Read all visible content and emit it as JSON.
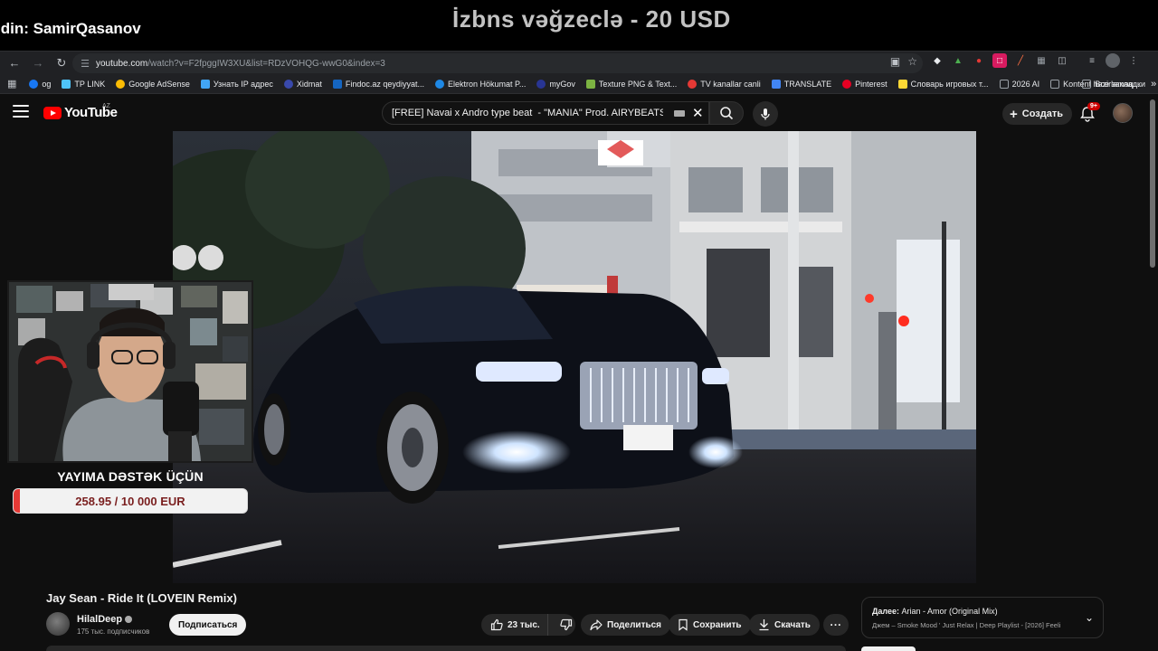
{
  "stream": {
    "ticker": "ldin: SamirQasanov",
    "donation_text": "İzbns vəğzeclə - 20 USD",
    "support_label": "YAYIMA DƏSTƏK ÜÇÜN",
    "goal_text": "258.95 / 10 000 EUR",
    "goal_progress": 0.0259
  },
  "browser": {
    "url_host": "youtube.com",
    "url_path": "/watch?v=F2fpggIW3XU&list=RDzVOHQG-wwG0&index=3",
    "bookmarks": [
      {
        "label": "og",
        "color": "#1877f2"
      },
      {
        "label": "TP LINK",
        "color": "#4fc3f7"
      },
      {
        "label": "Google AdSense",
        "color": "#fbbc04"
      },
      {
        "label": "Узнать IP адрес",
        "color": "#42a5f5"
      },
      {
        "label": "Xidmat",
        "color": "#3949ab"
      },
      {
        "label": "Findoc.az qeydiyyat...",
        "color": "#1565c0"
      },
      {
        "label": "Elektron Hökumat P...",
        "color": "#1e88e5"
      },
      {
        "label": "myGov",
        "color": "#283593"
      },
      {
        "label": "Texture PNG & Text...",
        "color": "#7cb342"
      },
      {
        "label": "TV kanallar canli",
        "color": "#e53935"
      },
      {
        "label": "TRANSLATE",
        "color": "#4285f4"
      },
      {
        "label": "Pinterest",
        "color": "#e60023"
      },
      {
        "label": "Словарь игровых т...",
        "color": "#fdd835"
      },
      {
        "label": "2026 AI",
        "color": "#9aa0a6"
      },
      {
        "label": "Kontent hazirlamaq...",
        "color": "#9aa0a6"
      }
    ],
    "all_bookmarks": "Все закладки",
    "more_bookmarks": "»"
  },
  "youtube": {
    "logo_text": "YouTube",
    "region": "AZ",
    "search_value": "[FREE] Navai x Andro type beat  - \"MANIA\" Prod. AIRYBEATS",
    "create_label": "Создать",
    "notif_count": "9+"
  },
  "video": {
    "title": "Jay Sean - Ride It (LOVEIN Remix)",
    "channel": "HilalDeep",
    "subscribers": "175 тыс. подписчиков",
    "subscribe_label": "Подписаться",
    "likes": "23 тыс.",
    "share_label": "Поделиться",
    "save_label": "Сохранить",
    "download_label": "Скачать",
    "more_label": "..."
  },
  "next_up": {
    "prefix": "Далее:",
    "title": "Arian - Amor (Original Mix)",
    "subtitle": "Джем – Smoke Mood ' Just Relax | Deep Playlist - [2026] Feeli"
  }
}
